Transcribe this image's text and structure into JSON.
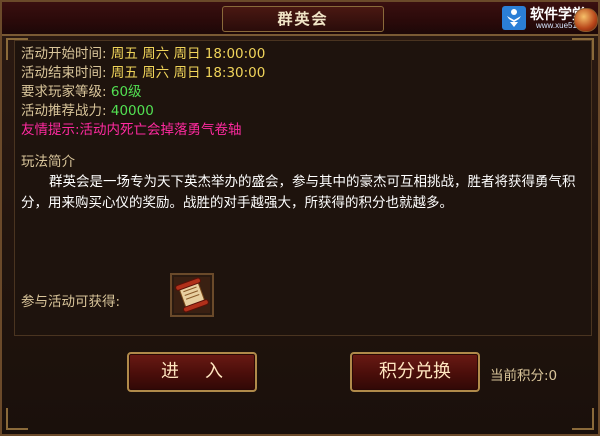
{
  "window": {
    "title": "群英会"
  },
  "watermark": {
    "name": "软件学堂",
    "url": "www.xue51.com"
  },
  "info": {
    "start_label": "活动开始时间:",
    "start_value": "周五 周六 周日 18:00:00",
    "end_label": "活动结束时间:",
    "end_value": "周五 周六 周日 18:30:00",
    "level_label": "要求玩家等级:",
    "level_value": "60级",
    "power_label": "活动推荐战力:",
    "power_value": "40000",
    "tip": "友情提示:活动内死亡会掉落勇气卷轴"
  },
  "description": {
    "title": "玩法简介",
    "text": "群英会是一场专为天下英杰举办的盛会，参与其中的豪杰可互相挑战，胜者将获得勇气积分，用来购买心仪的奖励。战胜的对手越强大，所获得的积分也就越多。"
  },
  "reward": {
    "label": "参与活动可获得:",
    "icon": "scroll-icon"
  },
  "buttons": {
    "enter": "进入",
    "exchange": "积分兑换"
  },
  "points": {
    "label": "当前积分:0"
  },
  "colors": {
    "label": "#d9c59a",
    "value_yellow": "#f0d45a",
    "value_green": "#52e052",
    "tip_pink": "#ff2aa0",
    "button_red": "#6a1a14",
    "frame_gold": "#b08a4a"
  }
}
